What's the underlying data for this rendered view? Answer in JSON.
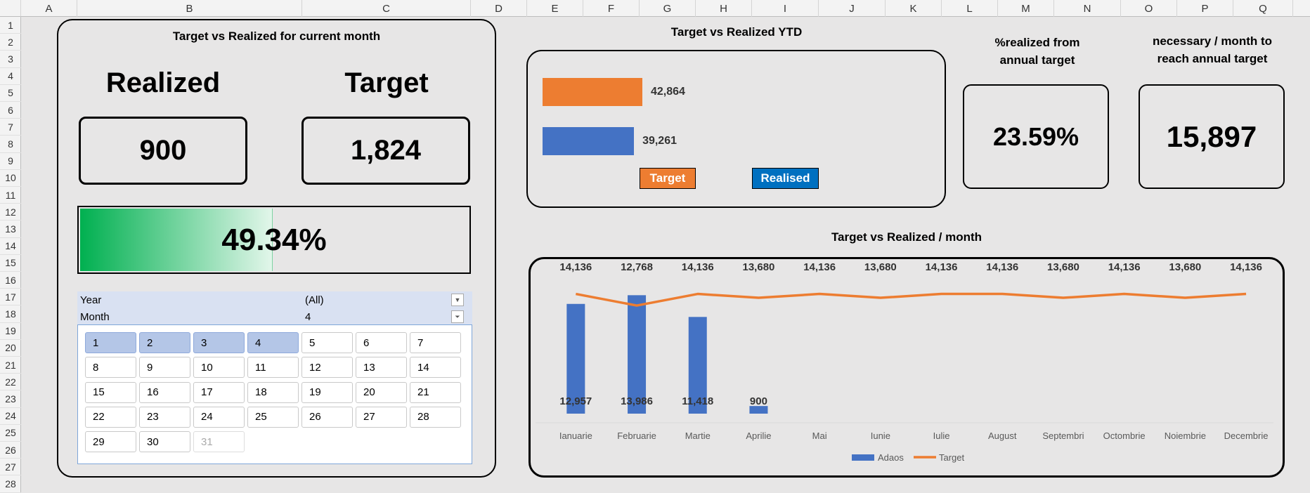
{
  "sheet": {
    "columns": [
      "A",
      "B",
      "C",
      "D",
      "E",
      "F",
      "G",
      "H",
      "I",
      "J",
      "K",
      "L",
      "M",
      "N",
      "O",
      "P",
      "Q"
    ],
    "rows": [
      "1",
      "2",
      "3",
      "4",
      "5",
      "6",
      "7",
      "8",
      "9",
      "10",
      "11",
      "12",
      "13",
      "14",
      "15",
      "16",
      "17",
      "18",
      "19",
      "20",
      "21",
      "22",
      "23",
      "24",
      "25",
      "26",
      "27",
      "28"
    ]
  },
  "month_panel": {
    "title": "Target vs Realized for current month",
    "realized_label": "Realized",
    "target_label": "Target",
    "realized_value": "900",
    "target_value": "1,824",
    "progress_text": "49.34%",
    "progress_fraction": 0.4934
  },
  "pivot": {
    "year_label": "Year",
    "year_value": "(All)",
    "month_label": "Month",
    "month_value": "4",
    "slicer_items": [
      "1",
      "2",
      "3",
      "4",
      "5",
      "6",
      "7",
      "8",
      "9",
      "10",
      "11",
      "12",
      "13",
      "14",
      "15",
      "16",
      "17",
      "18",
      "19",
      "20",
      "21",
      "22",
      "23",
      "24",
      "25",
      "26",
      "27",
      "28",
      "29",
      "30",
      "31"
    ],
    "selected": [
      "1",
      "2",
      "3",
      "4"
    ],
    "disabled": [
      "31"
    ]
  },
  "ytd_panel": {
    "title": "Target vs Realized YTD",
    "target_value_label": "42,864",
    "realised_value_label": "39,261",
    "target_value": 42864,
    "realised_value": 39261,
    "legend_target": "Target",
    "legend_realised": "Realised",
    "target_color": "#ed7d31",
    "realised_color": "#4472c4",
    "realised_legend_color": "#0070c0"
  },
  "kpi_percent": {
    "title_line1": "%realized from",
    "title_line2": "annual target",
    "value": "23.59%"
  },
  "kpi_necessary": {
    "title_line1": "necessary / month to",
    "title_line2": "reach annual target",
    "value": "15,897"
  },
  "chart_data": {
    "type": "bar",
    "title": "Target vs Realized / month",
    "categories": [
      "Ianuarie",
      "Februarie",
      "Martie",
      "Aprilie",
      "Mai",
      "Iunie",
      "Iulie",
      "August",
      "Septembri",
      "Octombrie",
      "Noiembrie",
      "Decembrie"
    ],
    "series": [
      {
        "name": "Adaos",
        "type": "bar",
        "color": "#4472c4",
        "values": [
          12957,
          13986,
          11418,
          900,
          null,
          null,
          null,
          null,
          null,
          null,
          null,
          null
        ]
      },
      {
        "name": "Target",
        "type": "line",
        "color": "#ed7d31",
        "values": [
          14136,
          12768,
          14136,
          13680,
          14136,
          13680,
          14136,
          14136,
          13680,
          14136,
          13680,
          14136
        ]
      }
    ],
    "bar_labels": [
      "12,957",
      "13,986",
      "11,418",
      "900"
    ],
    "line_labels": [
      "14,136",
      "12,768",
      "14,136",
      "13,680",
      "14,136",
      "13,680",
      "14,136",
      "14,136",
      "13,680",
      "14,136",
      "13,680",
      "14,136"
    ],
    "legend": [
      "Adaos",
      "Target"
    ],
    "legend_position": "bottom"
  }
}
